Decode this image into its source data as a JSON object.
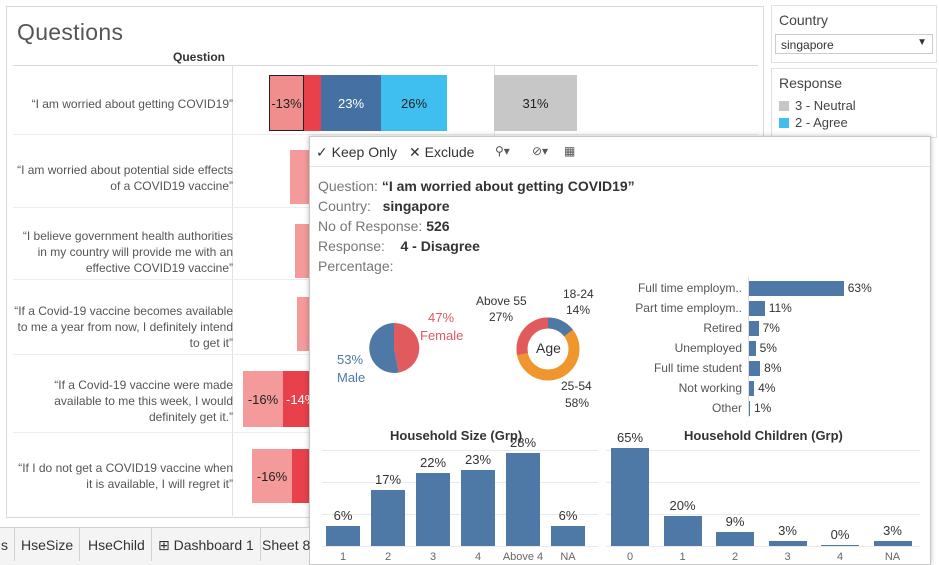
{
  "main": {
    "title": "Questions",
    "column_header": "Question",
    "questions": [
      "“I am worried about getting COVID19”",
      "“I am worried about potential side effects of a COVID19 vaccine”",
      "“I believe government health authorities in my country will provide me with an effective COVID19 vaccine”",
      "“If a Covid-19 vaccine becomes available to me a year from now, I definitely intend to get it”",
      "“If a Covid-19 vaccine were made available to me this week, I would definitely get it.”",
      "“If I do not get a COVID19 vaccine when it is available, I will regret it”"
    ],
    "bar_labels": {
      "r1_disagree": "-13%",
      "r1_agree": "23%",
      "r1_strong": "26%",
      "r1_neutral": "31%",
      "r5_a": "-16%",
      "r5_b": "-14%",
      "r6_a": "-16%"
    }
  },
  "filters": {
    "country_title": "Country",
    "country_value": "singapore",
    "response_title": "Response",
    "legend": [
      {
        "label": "3 - Neutral",
        "color": "#c7c7c7"
      },
      {
        "label": "2 - Agree",
        "color": "#3fbfef"
      }
    ]
  },
  "tooltip": {
    "keep_only": "✓ Keep Only",
    "exclude": "✕ Exclude",
    "question_label": "Question:",
    "question_value": "“I am worried about getting COVID19”",
    "country_label": "Country:",
    "country_value": "singapore",
    "responses_label": "No of Response:",
    "responses_value": "526",
    "response_label": "Response:",
    "response_value": "4 - Disagree",
    "percentage_label": "Percentage:",
    "gender": {
      "female_pct": "47%",
      "female": "Female",
      "male_pct": "53%",
      "male": "Male"
    },
    "age": {
      "center": "Age",
      "g1_label": "18-24",
      "g1_pct": "14%",
      "g2_label": "Above 55",
      "g2_pct": "27%",
      "g3_label": "25-54",
      "g3_pct": "58%"
    },
    "employment": [
      {
        "label": "Full time employm..",
        "value": "63%"
      },
      {
        "label": "Part time employm..",
        "value": "11%"
      },
      {
        "label": "Retired",
        "value": "7%"
      },
      {
        "label": "Unemployed",
        "value": "5%"
      },
      {
        "label": "Full time student",
        "value": "8%"
      },
      {
        "label": "Not working",
        "value": "4%"
      },
      {
        "label": "Other",
        "value": "1%"
      }
    ],
    "hh_title": "Household Size (Grp)",
    "hh": [
      {
        "x": "1",
        "label": "6%"
      },
      {
        "x": "2",
        "label": "17%"
      },
      {
        "x": "3",
        "label": "22%"
      },
      {
        "x": "4",
        "label": "23%"
      },
      {
        "x": "Above 4",
        "label": "28%"
      },
      {
        "x": "NA",
        "label": "6%"
      }
    ],
    "hc_title": "Household Children (Grp)",
    "hc": [
      {
        "x": "0",
        "label": "65%"
      },
      {
        "x": "1",
        "label": "20%"
      },
      {
        "x": "2",
        "label": "9%"
      },
      {
        "x": "3",
        "label": "3%"
      },
      {
        "x": "4",
        "label": "0%"
      },
      {
        "x": "NA",
        "label": "3%"
      }
    ]
  },
  "tabs": [
    "s",
    "HseSize",
    "HseChild",
    "⊞ Dashboard 1",
    "Sheet 8"
  ],
  "chart_data": [
    {
      "type": "bar",
      "title": "Household Size (Grp)",
      "categories": [
        "1",
        "2",
        "3",
        "4",
        "Above 4",
        "NA"
      ],
      "values": [
        6,
        17,
        22,
        23,
        28,
        6
      ]
    },
    {
      "type": "bar",
      "title": "Household Children (Grp)",
      "categories": [
        "0",
        "1",
        "2",
        "3",
        "4",
        "NA"
      ],
      "values": [
        65,
        20,
        9,
        3,
        0,
        3
      ]
    },
    {
      "type": "bar",
      "title": "",
      "categories": [
        "Full time employm..",
        "Part time employm..",
        "Retired",
        "Unemployed",
        "Full time student",
        "Not working",
        "Other"
      ],
      "values": [
        63,
        11,
        7,
        5,
        8,
        4,
        1
      ]
    },
    {
      "type": "pie",
      "title": "",
      "categories": [
        "Female",
        "Male"
      ],
      "values": [
        47,
        53
      ]
    },
    {
      "type": "pie",
      "title": "",
      "categories": [
        "18-24",
        "25-54",
        "Above 55"
      ],
      "values": [
        14,
        58,
        27
      ]
    }
  ]
}
